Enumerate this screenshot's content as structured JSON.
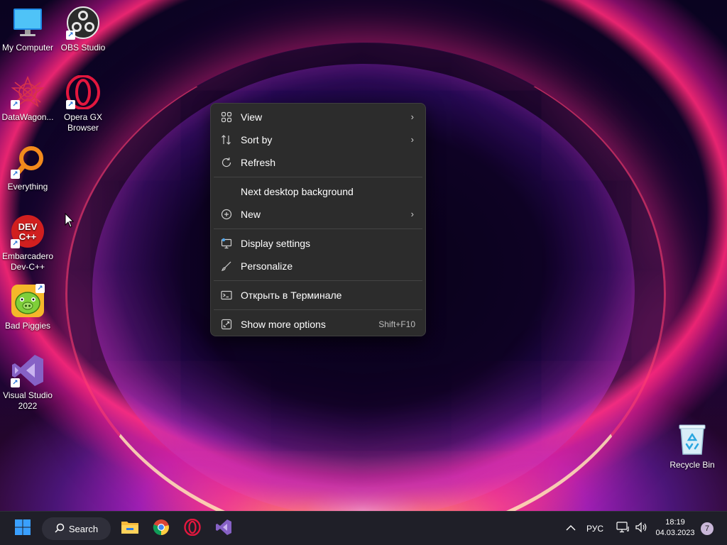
{
  "desktop": {
    "icons": [
      {
        "label": "My Computer"
      },
      {
        "label": "OBS Studio"
      },
      {
        "label": "DataWagon..."
      },
      {
        "label": "Opera GX Browser"
      },
      {
        "label": "Everything"
      },
      {
        "label": "Embarcadero Dev-C++"
      },
      {
        "label": "Bad Piggies"
      },
      {
        "label": "Visual Studio 2022"
      },
      {
        "label": "Recycle Bin"
      }
    ],
    "devcpp_logo_text": "DEV C++"
  },
  "context_menu": {
    "items": [
      {
        "label": "View",
        "icon": "grid-view-icon",
        "has_submenu": true
      },
      {
        "label": "Sort by",
        "icon": "sort-icon",
        "has_submenu": true
      },
      {
        "label": "Refresh",
        "icon": "refresh-icon",
        "has_submenu": false
      },
      {
        "label": "Next desktop background",
        "icon": "",
        "has_submenu": false
      },
      {
        "label": "New",
        "icon": "plus-circle-icon",
        "has_submenu": true
      },
      {
        "label": "Display settings",
        "icon": "display-icon",
        "has_submenu": false
      },
      {
        "label": "Personalize",
        "icon": "brush-icon",
        "has_submenu": false
      },
      {
        "label": "Открыть в Терминале",
        "icon": "terminal-icon",
        "has_submenu": false
      },
      {
        "label": "Show more options",
        "icon": "more-options-icon",
        "shortcut": "Shift+F10"
      }
    ]
  },
  "taskbar": {
    "search_label": "Search",
    "language": "РУС",
    "time": "18:19",
    "date": "04.03.2023",
    "notification_count": "7"
  },
  "colors": {
    "menu_bg": "#2c2c2c",
    "taskbar_bg": "#1f1f28",
    "windows_blue": "#3aa0ff",
    "opera_red": "#e3173e",
    "vs_purple": "#8661c5"
  }
}
